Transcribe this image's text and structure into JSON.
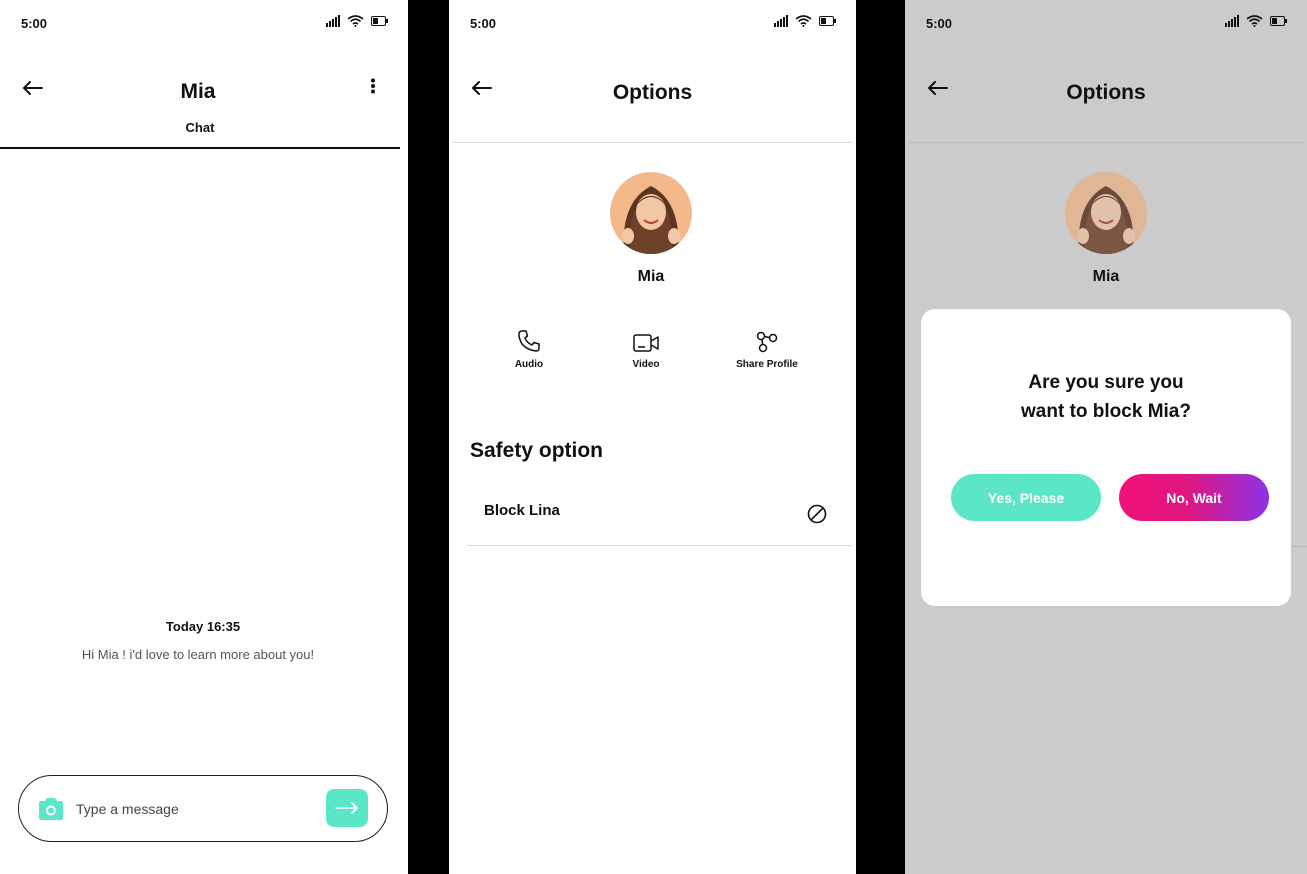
{
  "chat_screen": {
    "status_time": "5:00",
    "title": "Mia",
    "tab_label": "Chat",
    "message_time": "Today 16:35",
    "message_text": "Hi Mia ! i'd love to learn more about you!",
    "input_placeholder": "Type a message",
    "icons": [
      "back-arrow-icon",
      "more-vert-icon",
      "camera-icon",
      "send-arrow-icon"
    ]
  },
  "options_screen": {
    "status_time": "5:00",
    "title": "Options",
    "profile_name": "Mia",
    "actions": [
      {
        "label": "Audio",
        "icon": "phone-icon"
      },
      {
        "label": "Video",
        "icon": "video-icon"
      },
      {
        "label": "Share Profile",
        "icon": "share-icon"
      }
    ],
    "safety_title": "Safety option",
    "block_label": "Block Lina",
    "block_icon": "block-icon"
  },
  "confirm_screen": {
    "status_time": "5:00",
    "title": "Options",
    "profile_name": "Mia",
    "dialog": {
      "question_line1": "Are you sure you",
      "question_line2": "want to block Mia?",
      "yes_label": "Yes, Please",
      "no_label": "No, Wait"
    }
  },
  "colors": {
    "accent_teal": "#5ce6c8",
    "gradient_start": "#f0127a",
    "gradient_end": "#8d33e6",
    "overlay_gray": "#cbcbcb"
  }
}
